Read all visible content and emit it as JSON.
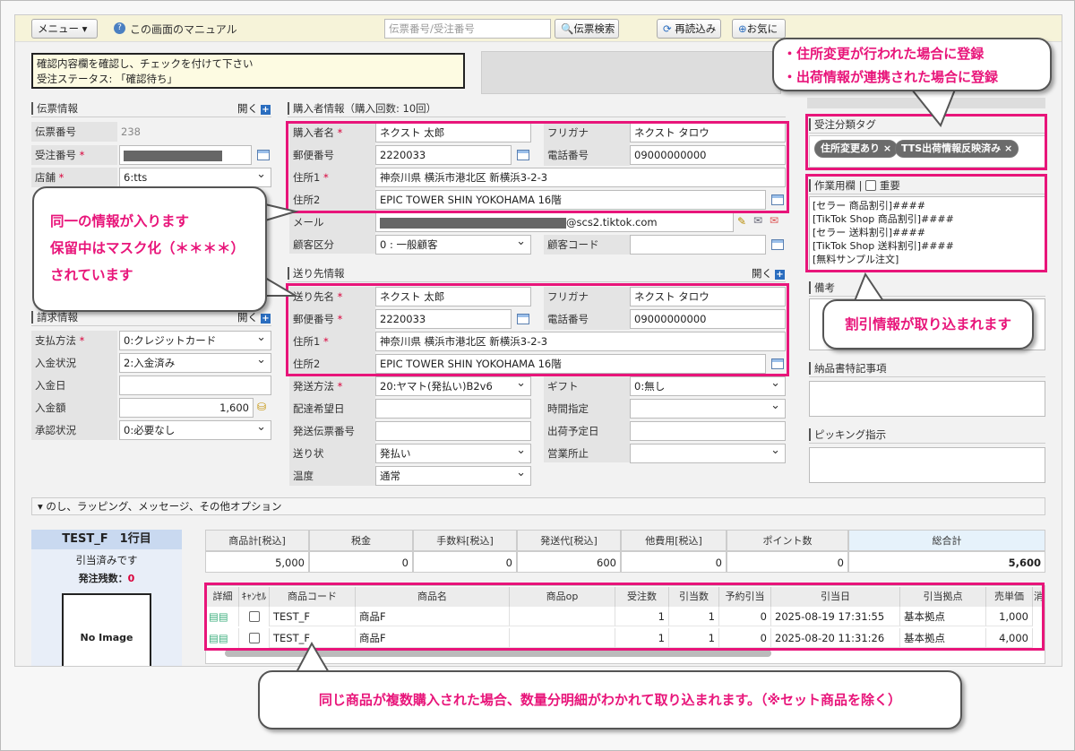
{
  "toolbar": {
    "menu": "メニュー ▾",
    "manual": "この画面のマニュアル",
    "search_placeholder": "伝票番号/受注番号",
    "search_btn": "伝票検索",
    "reload": "再読込み",
    "fav": "お気に"
  },
  "notice": {
    "line1": "確認内容欄を確認し、チェックを付けて下さい",
    "line2": "受注ステータス: 「確認待ち」"
  },
  "denpyo": {
    "title": "伝票情報",
    "open": "開く",
    "fields": [
      {
        "label": "伝票番号",
        "value": "238"
      },
      {
        "label": "受注番号",
        "value": ""
      },
      {
        "label": "店舗",
        "value": "6:tts"
      }
    ]
  },
  "seikyu": {
    "title": "請求情報",
    "open": "開く",
    "fields": [
      {
        "label": "支払方法",
        "value": "0:クレジットカード"
      },
      {
        "label": "入金状況",
        "value": "2:入金済み"
      },
      {
        "label": "入金日",
        "value": ""
      },
      {
        "label": "入金額",
        "value": "1,600"
      },
      {
        "label": "承認状況",
        "value": "0:必要なし"
      }
    ]
  },
  "buyer": {
    "title": "購入者情報（購入回数: 10回）",
    "name_label": "購入者名",
    "name": "ネクスト 太郎",
    "kana_label": "フリガナ",
    "kana": "ネクスト タロウ",
    "zip_label": "郵便番号",
    "zip": "2220033",
    "tel_label": "電話番号",
    "tel": "09000000000",
    "addr1_label": "住所1",
    "addr1": "神奈川県 横浜市港北区 新横浜3-2-3",
    "addr2_label": "住所2",
    "addr2": "EPIC TOWER SHIN YOKOHAMA 16階",
    "mail_label": "メール",
    "mail": "@scs2.tiktok.com",
    "kubun_label": "顧客区分",
    "kubun": "0 : 一般顧客",
    "code_label": "顧客コード"
  },
  "ship": {
    "title": "送り先情報",
    "open": "開く",
    "name_label": "送り先名",
    "name": "ネクスト 太郎",
    "kana_label": "フリガナ",
    "kana": "ネクスト タロウ",
    "zip_label": "郵便番号",
    "zip": "2220033",
    "tel_label": "電話番号",
    "tel": "09000000000",
    "addr1_label": "住所1",
    "addr1": "神奈川県 横浜市港北区 新横浜3-2-3",
    "addr2_label": "住所2",
    "addr2": "EPIC TOWER SHIN YOKOHAMA 16階",
    "method_label": "発送方法",
    "method": "20:ヤマト(発払い)B2v6",
    "gift_label": "ギフト",
    "gift": "0:無し",
    "hope_label": "配達希望日",
    "time_label": "時間指定",
    "slip_label": "発送伝票番号",
    "ship_date_label": "出荷予定日",
    "okuri_label": "送り状",
    "okuri": "発払い",
    "office_label": "営業所止",
    "temp_label": "温度",
    "temp": "通常"
  },
  "right": {
    "tag_title": "受注分類タグ",
    "tags": [
      "住所変更あり",
      "TTS出荷情報反映済み"
    ],
    "work_title": "作業用欄",
    "important": "重要",
    "work_text": "[セラー 商品割引]####\n[TikTok Shop 商品割引]####\n[セラー 送料割引]####\n[TikTok Shop 送料割引]####\n[無料サンプル注文]",
    "biko": "備考",
    "nohin": "納品書特記事項",
    "picking": "ピッキング指示"
  },
  "options_bar": "▾ のし、ラッピング、メッセージ、その他オプション",
  "item_panel": {
    "title": "TEST_F　1行目",
    "status": "引当済みです",
    "remain_label": "発注残数：",
    "remain": "0",
    "noimage": "No Image"
  },
  "totals": {
    "headers": [
      "商品計[税込]",
      "税金",
      "手数料[税込]",
      "発送代[税込]",
      "他費用[税込]",
      "ポイント数",
      "総合計"
    ],
    "values": [
      "5,000",
      "0",
      "0",
      "600",
      "0",
      "0",
      "5,600"
    ]
  },
  "lines": {
    "headers": [
      "詳細",
      "ｷｬﾝｾﾙ",
      "商品コード",
      "商品名",
      "商品op",
      "受注数",
      "引当数",
      "予約引当",
      "引当日",
      "引当拠点",
      "売単価",
      "消"
    ],
    "rows": [
      [
        "TEST_F",
        "商品F",
        "",
        "1",
        "1",
        "0",
        "2025-08-19 17:31:55",
        "基本拠点",
        "1,000"
      ],
      [
        "TEST_F",
        "商品F",
        "",
        "1",
        "1",
        "0",
        "2025-08-20 11:31:26",
        "基本拠点",
        "4,000"
      ]
    ]
  },
  "callouts": {
    "top_right_1": "・住所変更が行われた場合に登録",
    "top_right_2": "・出荷情報が連携された場合に登録",
    "left_1": "同一の情報が入ります",
    "left_2": "保留中はマスク化（＊＊＊＊）",
    "left_3": "されています",
    "discount": "割引情報が取り込まれます",
    "bottom": "同じ商品が複数購入された場合、数量分明細がわかれて取り込まれます。（※セット商品を除く）"
  }
}
